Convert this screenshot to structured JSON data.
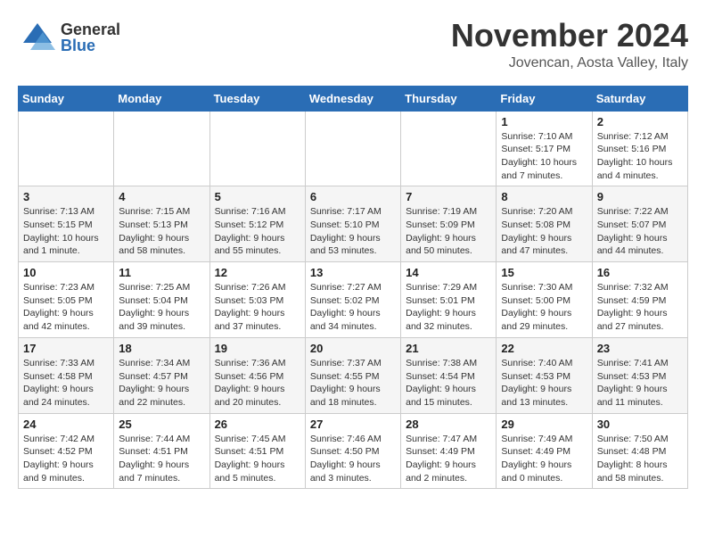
{
  "header": {
    "logo_general": "General",
    "logo_blue": "Blue",
    "month": "November 2024",
    "location": "Jovencan, Aosta Valley, Italy"
  },
  "weekdays": [
    "Sunday",
    "Monday",
    "Tuesday",
    "Wednesday",
    "Thursday",
    "Friday",
    "Saturday"
  ],
  "weeks": [
    [
      {
        "day": "",
        "info": ""
      },
      {
        "day": "",
        "info": ""
      },
      {
        "day": "",
        "info": ""
      },
      {
        "day": "",
        "info": ""
      },
      {
        "day": "",
        "info": ""
      },
      {
        "day": "1",
        "info": "Sunrise: 7:10 AM\nSunset: 5:17 PM\nDaylight: 10 hours\nand 7 minutes."
      },
      {
        "day": "2",
        "info": "Sunrise: 7:12 AM\nSunset: 5:16 PM\nDaylight: 10 hours\nand 4 minutes."
      }
    ],
    [
      {
        "day": "3",
        "info": "Sunrise: 7:13 AM\nSunset: 5:15 PM\nDaylight: 10 hours\nand 1 minute."
      },
      {
        "day": "4",
        "info": "Sunrise: 7:15 AM\nSunset: 5:13 PM\nDaylight: 9 hours\nand 58 minutes."
      },
      {
        "day": "5",
        "info": "Sunrise: 7:16 AM\nSunset: 5:12 PM\nDaylight: 9 hours\nand 55 minutes."
      },
      {
        "day": "6",
        "info": "Sunrise: 7:17 AM\nSunset: 5:10 PM\nDaylight: 9 hours\nand 53 minutes."
      },
      {
        "day": "7",
        "info": "Sunrise: 7:19 AM\nSunset: 5:09 PM\nDaylight: 9 hours\nand 50 minutes."
      },
      {
        "day": "8",
        "info": "Sunrise: 7:20 AM\nSunset: 5:08 PM\nDaylight: 9 hours\nand 47 minutes."
      },
      {
        "day": "9",
        "info": "Sunrise: 7:22 AM\nSunset: 5:07 PM\nDaylight: 9 hours\nand 44 minutes."
      }
    ],
    [
      {
        "day": "10",
        "info": "Sunrise: 7:23 AM\nSunset: 5:05 PM\nDaylight: 9 hours\nand 42 minutes."
      },
      {
        "day": "11",
        "info": "Sunrise: 7:25 AM\nSunset: 5:04 PM\nDaylight: 9 hours\nand 39 minutes."
      },
      {
        "day": "12",
        "info": "Sunrise: 7:26 AM\nSunset: 5:03 PM\nDaylight: 9 hours\nand 37 minutes."
      },
      {
        "day": "13",
        "info": "Sunrise: 7:27 AM\nSunset: 5:02 PM\nDaylight: 9 hours\nand 34 minutes."
      },
      {
        "day": "14",
        "info": "Sunrise: 7:29 AM\nSunset: 5:01 PM\nDaylight: 9 hours\nand 32 minutes."
      },
      {
        "day": "15",
        "info": "Sunrise: 7:30 AM\nSunset: 5:00 PM\nDaylight: 9 hours\nand 29 minutes."
      },
      {
        "day": "16",
        "info": "Sunrise: 7:32 AM\nSunset: 4:59 PM\nDaylight: 9 hours\nand 27 minutes."
      }
    ],
    [
      {
        "day": "17",
        "info": "Sunrise: 7:33 AM\nSunset: 4:58 PM\nDaylight: 9 hours\nand 24 minutes."
      },
      {
        "day": "18",
        "info": "Sunrise: 7:34 AM\nSunset: 4:57 PM\nDaylight: 9 hours\nand 22 minutes."
      },
      {
        "day": "19",
        "info": "Sunrise: 7:36 AM\nSunset: 4:56 PM\nDaylight: 9 hours\nand 20 minutes."
      },
      {
        "day": "20",
        "info": "Sunrise: 7:37 AM\nSunset: 4:55 PM\nDaylight: 9 hours\nand 18 minutes."
      },
      {
        "day": "21",
        "info": "Sunrise: 7:38 AM\nSunset: 4:54 PM\nDaylight: 9 hours\nand 15 minutes."
      },
      {
        "day": "22",
        "info": "Sunrise: 7:40 AM\nSunset: 4:53 PM\nDaylight: 9 hours\nand 13 minutes."
      },
      {
        "day": "23",
        "info": "Sunrise: 7:41 AM\nSunset: 4:53 PM\nDaylight: 9 hours\nand 11 minutes."
      }
    ],
    [
      {
        "day": "24",
        "info": "Sunrise: 7:42 AM\nSunset: 4:52 PM\nDaylight: 9 hours\nand 9 minutes."
      },
      {
        "day": "25",
        "info": "Sunrise: 7:44 AM\nSunset: 4:51 PM\nDaylight: 9 hours\nand 7 minutes."
      },
      {
        "day": "26",
        "info": "Sunrise: 7:45 AM\nSunset: 4:51 PM\nDaylight: 9 hours\nand 5 minutes."
      },
      {
        "day": "27",
        "info": "Sunrise: 7:46 AM\nSunset: 4:50 PM\nDaylight: 9 hours\nand 3 minutes."
      },
      {
        "day": "28",
        "info": "Sunrise: 7:47 AM\nSunset: 4:49 PM\nDaylight: 9 hours\nand 2 minutes."
      },
      {
        "day": "29",
        "info": "Sunrise: 7:49 AM\nSunset: 4:49 PM\nDaylight: 9 hours\nand 0 minutes."
      },
      {
        "day": "30",
        "info": "Sunrise: 7:50 AM\nSunset: 4:48 PM\nDaylight: 8 hours\nand 58 minutes."
      }
    ]
  ]
}
